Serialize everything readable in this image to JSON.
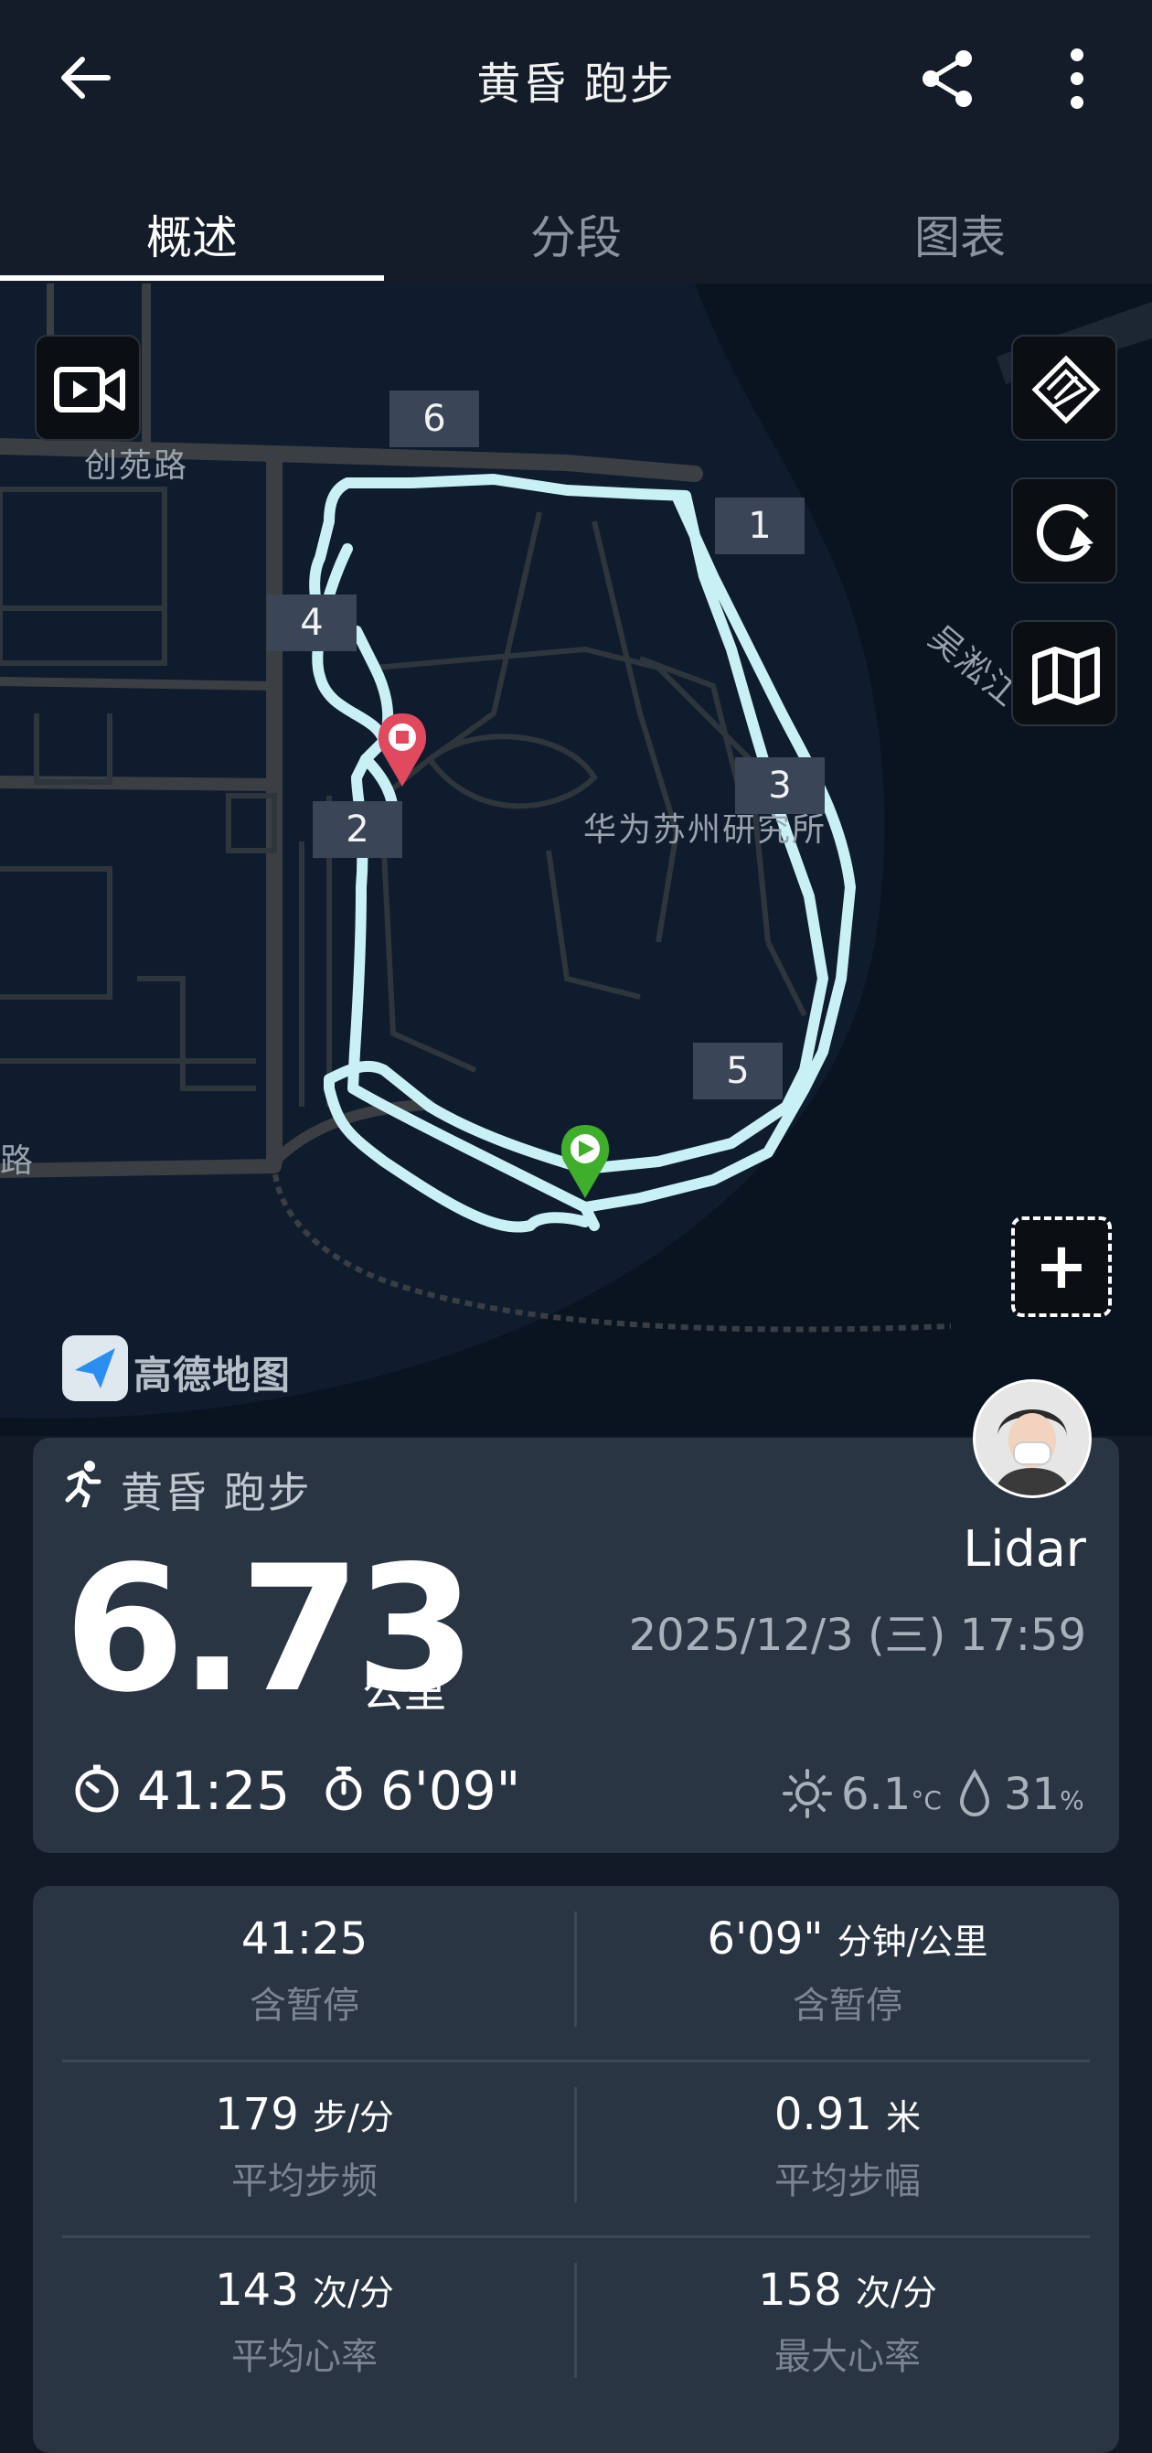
{
  "header": {
    "title": "黄昏 跑步",
    "icons": [
      "back-arrow-icon",
      "share-icon",
      "more-vertical-icon"
    ]
  },
  "tabs": [
    {
      "label": "概述",
      "active": true
    },
    {
      "label": "分段",
      "active": false
    },
    {
      "label": "图表",
      "active": false
    }
  ],
  "map": {
    "labels": {
      "road_1": "创苑路",
      "road_2": "吴淞江",
      "place": "华为苏州研究所",
      "road_3": "路"
    },
    "splits": [
      "1",
      "2",
      "3",
      "4",
      "5",
      "6"
    ],
    "logo_text": "高德地图",
    "controls": [
      "video-icon",
      "3d-view-icon",
      "replay-icon",
      "map-layers-icon",
      "add-icon"
    ]
  },
  "summary": {
    "activity_type": "黄昏 跑步",
    "distance": "6.73",
    "distance_unit": "公里",
    "user_name": "Lidar",
    "datetime": "2025/12/3 (三) 17:59",
    "duration": "41:25",
    "pace": "6'09\"",
    "temperature": "6.1",
    "temperature_unit": "°C",
    "humidity": "31",
    "humidity_unit": "%"
  },
  "metrics": [
    {
      "value": "41:25",
      "unit": "",
      "label": "含暂停"
    },
    {
      "value": "6'09\"",
      "unit": "分钟/公里",
      "label": "含暂停"
    },
    {
      "value": "179",
      "unit": "步/分",
      "label": "平均步频"
    },
    {
      "value": "0.91",
      "unit": "米",
      "label": "平均步幅"
    },
    {
      "value": "143",
      "unit": "次/分",
      "label": "平均心率"
    },
    {
      "value": "158",
      "unit": "次/分",
      "label": "最大心率"
    }
  ]
}
